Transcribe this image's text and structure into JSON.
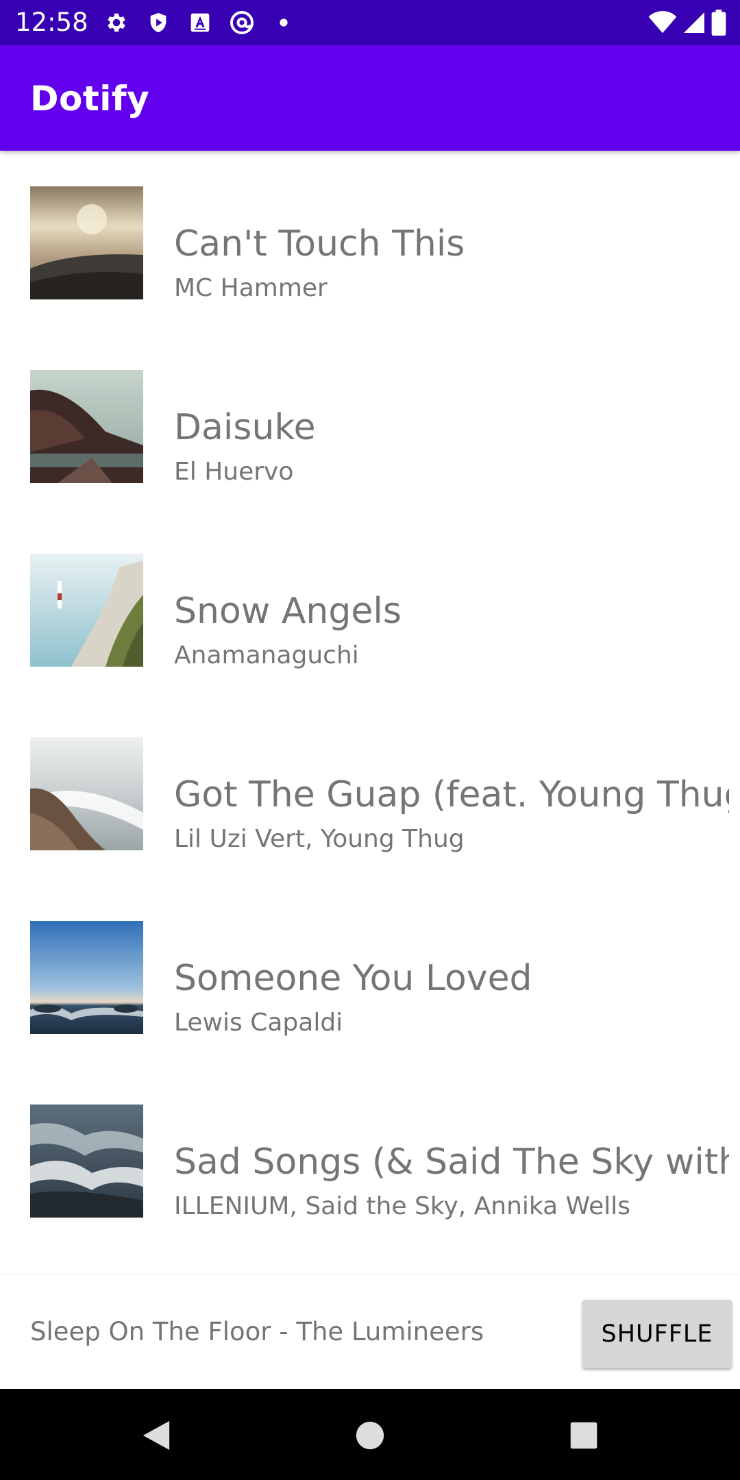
{
  "status_bar": {
    "time": "12:58",
    "left_icons": [
      "gear-icon",
      "shield-icon",
      "a-box-icon",
      "at-circle-icon",
      "dot-icon"
    ],
    "right_icons": [
      "wifi-icon",
      "signal-icon",
      "battery-icon"
    ]
  },
  "app_bar": {
    "title": "Dotify"
  },
  "songs": [
    {
      "title": "Can't Touch This",
      "artist": "MC Hammer"
    },
    {
      "title": "Daisuke",
      "artist": "El Huervo"
    },
    {
      "title": "Snow Angels",
      "artist": "Anamanaguchi"
    },
    {
      "title": "Got The Guap (feat. Young Thug",
      "artist": "Lil Uzi Vert, Young Thug"
    },
    {
      "title": "Someone You Loved",
      "artist": "Lewis Capaldi"
    },
    {
      "title": "Sad Songs (& Said The Sky with",
      "artist": "ILLENIUM, Said the Sky, Annika Wells"
    }
  ],
  "mini_player": {
    "now_playing": "Sleep On The Floor - The Lumineers",
    "shuffle_label": "SHUFFLE"
  },
  "nav_bar": {
    "icons": [
      "back-icon",
      "home-icon",
      "recents-icon"
    ]
  },
  "colors": {
    "status_bar": "#3700b3",
    "app_bar": "#6200ee",
    "text_secondary": "#757575",
    "button_bg": "#d6d6d6"
  }
}
